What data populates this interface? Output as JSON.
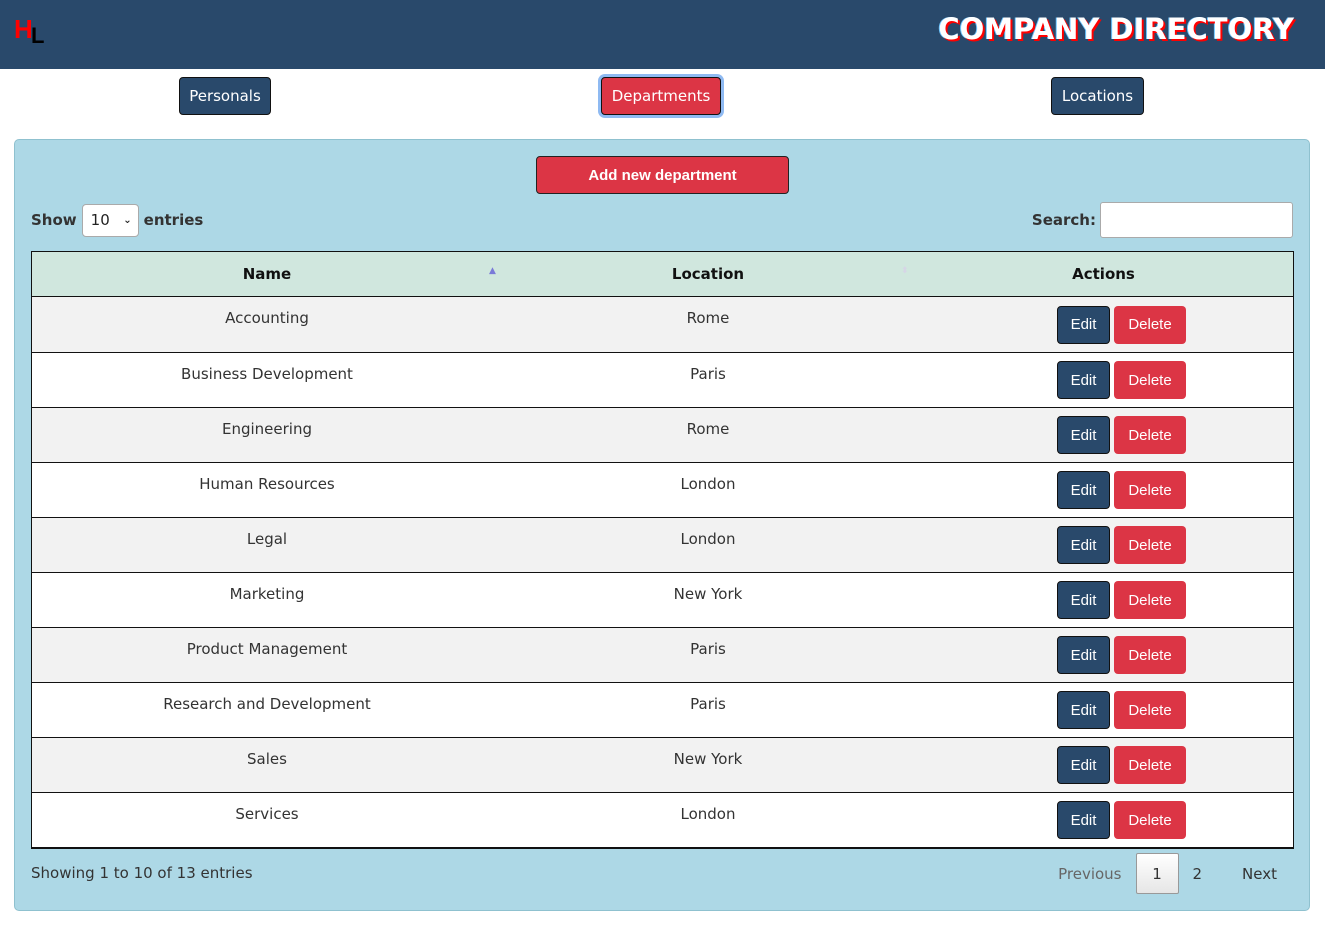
{
  "header": {
    "logo": {
      "first": "H",
      "second": "L"
    },
    "title": "COMPANY DIRECTORY"
  },
  "nav": {
    "personals": "Personals",
    "departments": "Departments",
    "locations": "Locations",
    "active": "Departments"
  },
  "toolbar": {
    "add_label": "Add new department",
    "show_label": "Show",
    "entries_label": "entries",
    "page_size": "10",
    "search_label": "Search:",
    "search_value": "",
    "search_placeholder": ""
  },
  "table": {
    "columns": [
      {
        "label": "Name",
        "sort": "ascending"
      },
      {
        "label": "Location",
        "sort": "none"
      },
      {
        "label": "Actions"
      }
    ],
    "rows": [
      {
        "name": "Accounting",
        "location": "Rome"
      },
      {
        "name": "Business Development",
        "location": "Paris"
      },
      {
        "name": "Engineering",
        "location": "Rome"
      },
      {
        "name": "Human Resources",
        "location": "London"
      },
      {
        "name": "Legal",
        "location": "London"
      },
      {
        "name": "Marketing",
        "location": "New York"
      },
      {
        "name": "Product Management",
        "location": "Paris"
      },
      {
        "name": "Research and Development",
        "location": "Paris"
      },
      {
        "name": "Sales",
        "location": "New York"
      },
      {
        "name": "Services",
        "location": "London"
      }
    ],
    "edit_label": "Edit",
    "delete_label": "Delete"
  },
  "footer": {
    "info": "Showing 1 to 10 of 13 entries",
    "pagination": {
      "previous": "Previous",
      "pages": [
        "1",
        "2"
      ],
      "current": "1",
      "next": "Next"
    }
  },
  "colors": {
    "navy": "#29496b",
    "red": "#dc3545",
    "panel": "#add8e6",
    "table_header": "#d0e7de"
  },
  "icons": {
    "sort_asc": "▲",
    "sort_both": "⬍",
    "select_chevron": "⌄"
  }
}
